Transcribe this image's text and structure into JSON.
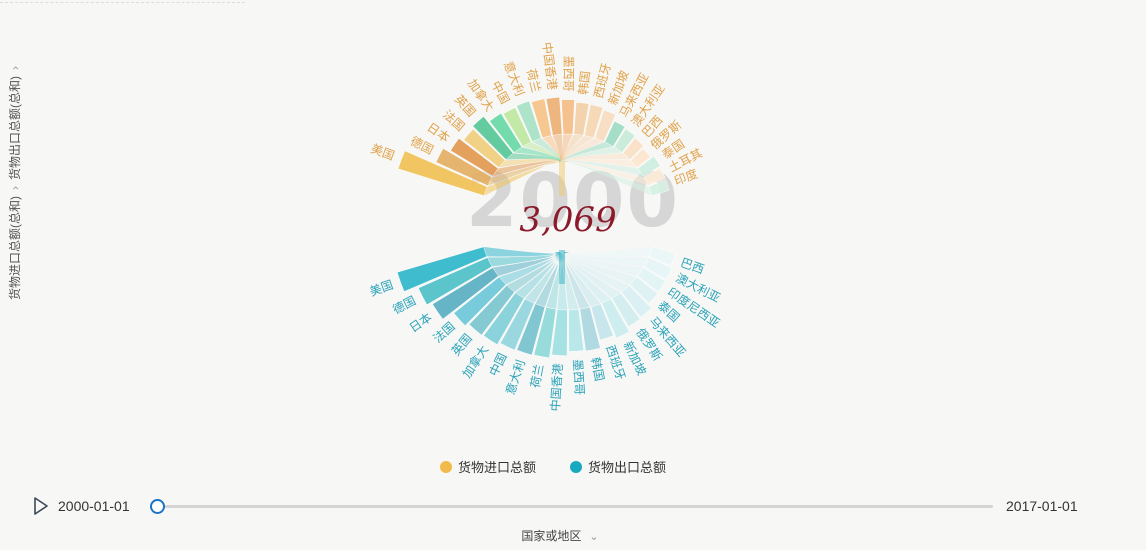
{
  "breadcrumb": {
    "items": [
      "货物进口总额(总和)",
      "货物出口总额(总和)"
    ]
  },
  "year": "2000",
  "total_display": "3,069",
  "legend": [
    {
      "label": "货物进口总额",
      "color": "#f2b94b"
    },
    {
      "label": "货物出口总额",
      "color": "#19a9bf"
    }
  ],
  "timeline": {
    "start_label": "2000-01-01",
    "end_label": "2017-01-01",
    "progress": 0
  },
  "dimension_select": {
    "label": "国家或地区"
  },
  "chart_data": {
    "type": "radial-bar",
    "series": [
      {
        "name": "货物进口总额",
        "categories": [
          "美国",
          "德国",
          "日本",
          "法国",
          "英国",
          "加拿大",
          "中国",
          "意大利",
          "荷兰",
          "中国香港",
          "墨西哥",
          "韩国",
          "西班牙",
          "新加坡",
          "马来西亚",
          "澳大利亚",
          "巴西",
          "俄罗斯",
          "泰国",
          "土耳其",
          "印度"
        ],
        "values": [
          1259,
          503,
          380,
          311,
          345,
          245,
          225,
          238,
          218,
          214,
          183,
          160,
          155,
          135,
          82,
          71,
          58,
          45,
          62,
          54,
          51
        ],
        "colors": [
          "#f1c256",
          "#e4b064",
          "#e39a52",
          "#f1ce7c",
          "#57c896",
          "#68d9a6",
          "#bfe8a0",
          "#a6e2c6",
          "#f7c48a",
          "#ecb174",
          "#f5bd86",
          "#f3d1a7",
          "#f6d7b2",
          "#f8dcc0",
          "#9fdcc5",
          "#c8ecd8",
          "#fbe1c6",
          "#fde7cf",
          "#cdeee0",
          "#fdecd8",
          "#d6f1e4"
        ]
      },
      {
        "name": "货物出口总额",
        "categories": [
          "美国",
          "德国",
          "日本",
          "法国",
          "英国",
          "加拿大",
          "中国",
          "意大利",
          "荷兰",
          "中国香港",
          "墨西哥",
          "韩国",
          "西班牙",
          "新加坡",
          "俄罗斯",
          "马来西亚",
          "泰国",
          "印度尼西亚",
          "澳大利亚",
          "巴西"
        ],
        "values": [
          782,
          551,
          479,
          325,
          285,
          277,
          249,
          240,
          233,
          202,
          166,
          172,
          114,
          138,
          105,
          98,
          69,
          65,
          64,
          55
        ],
        "colors": [
          "#31b7cc",
          "#4fc1c9",
          "#5ab0c4",
          "#6dc8d8",
          "#7cc7cf",
          "#82d0d9",
          "#94d5dc",
          "#78c3cf",
          "#8fd9d9",
          "#a0e0e3",
          "#b5e6e8",
          "#aad7e0",
          "#c3e6ec",
          "#cbedef",
          "#d2eef0",
          "#d8f0f2",
          "#ddf2f3",
          "#e2f4f5",
          "#e6f5f6",
          "#eaf7f8"
        ]
      }
    ],
    "title": "",
    "xlabel": "",
    "ylabel": ""
  }
}
